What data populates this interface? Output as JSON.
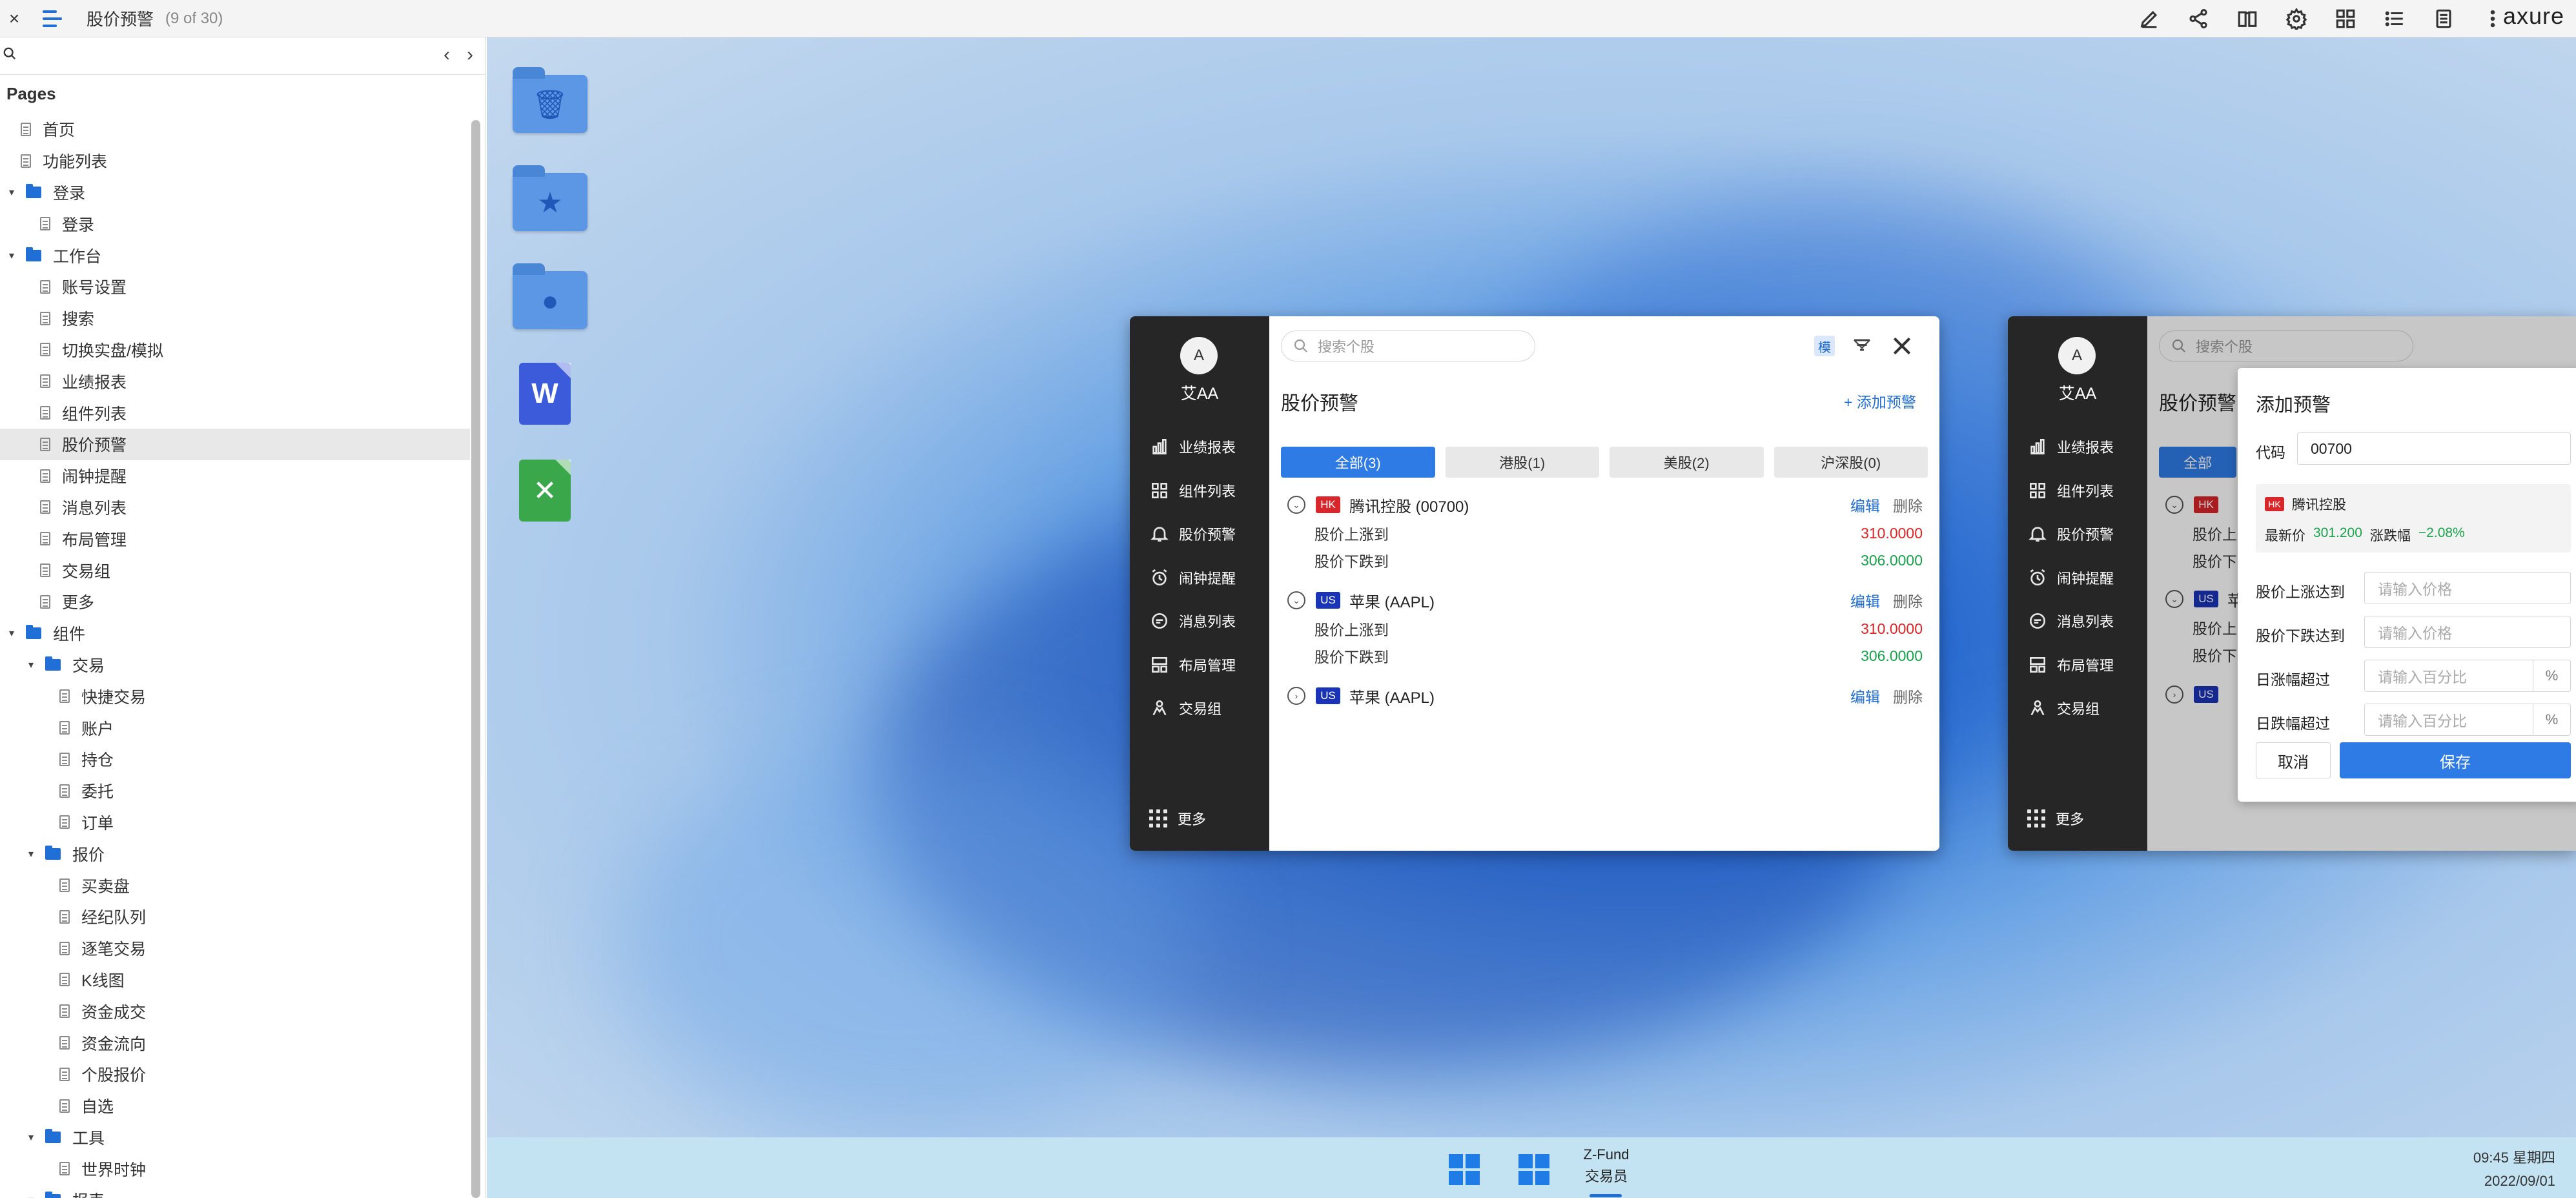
{
  "topbar": {
    "close_glyph": "×",
    "page_name": "股价预警",
    "page_count": "(9 of 30)",
    "tool_icons": [
      "pencil-icon",
      "share-icon",
      "book-icon",
      "settings-icon",
      "grid-icon",
      "list-icon",
      "document-icon",
      "more-icon"
    ],
    "brand": "axure"
  },
  "sidebar": {
    "nav_prev": "‹",
    "nav_next": "›",
    "pages_title": "Pages",
    "tree": [
      {
        "label": "首页",
        "type": "page",
        "level": 0
      },
      {
        "label": "功能列表",
        "type": "page",
        "level": 0
      },
      {
        "label": "登录",
        "type": "folder",
        "level": 0
      },
      {
        "label": "登录",
        "type": "page",
        "level": 1
      },
      {
        "label": "工作台",
        "type": "folder",
        "level": 0
      },
      {
        "label": "账号设置",
        "type": "page",
        "level": 1
      },
      {
        "label": "搜索",
        "type": "page",
        "level": 1
      },
      {
        "label": "切换实盘/模拟",
        "type": "page",
        "level": 1
      },
      {
        "label": "业绩报表",
        "type": "page",
        "level": 1
      },
      {
        "label": "组件列表",
        "type": "page",
        "level": 1
      },
      {
        "label": "股价预警",
        "type": "page",
        "level": 1,
        "selected": true
      },
      {
        "label": "闹钟提醒",
        "type": "page",
        "level": 1
      },
      {
        "label": "消息列表",
        "type": "page",
        "level": 1
      },
      {
        "label": "布局管理",
        "type": "page",
        "level": 1
      },
      {
        "label": "交易组",
        "type": "page",
        "level": 1
      },
      {
        "label": "更多",
        "type": "page",
        "level": 1
      },
      {
        "label": "组件",
        "type": "folder",
        "level": 0
      },
      {
        "label": "交易",
        "type": "folder",
        "level": 1
      },
      {
        "label": "快捷交易",
        "type": "page",
        "level": 2
      },
      {
        "label": "账户",
        "type": "page",
        "level": 2
      },
      {
        "label": "持仓",
        "type": "page",
        "level": 2
      },
      {
        "label": "委托",
        "type": "page",
        "level": 2
      },
      {
        "label": "订单",
        "type": "page",
        "level": 2
      },
      {
        "label": "报价",
        "type": "folder",
        "level": 1
      },
      {
        "label": "买卖盘",
        "type": "page",
        "level": 2
      },
      {
        "label": "经纪队列",
        "type": "page",
        "level": 2
      },
      {
        "label": "逐笔交易",
        "type": "page",
        "level": 2
      },
      {
        "label": "K线图",
        "type": "page",
        "level": 2
      },
      {
        "label": "资金成交",
        "type": "page",
        "level": 2
      },
      {
        "label": "资金流向",
        "type": "page",
        "level": 2
      },
      {
        "label": "个股报价",
        "type": "page",
        "level": 2
      },
      {
        "label": "自选",
        "type": "page",
        "level": 2
      },
      {
        "label": "工具",
        "type": "folder",
        "level": 1
      },
      {
        "label": "世界时钟",
        "type": "page",
        "level": 2
      },
      {
        "label": "报表",
        "type": "folder",
        "level": 1
      }
    ]
  },
  "desktop": {
    "icons": [
      "trash-folder-icon",
      "favorites-folder-icon",
      "user-folder-icon",
      "word-doc-icon",
      "excel-doc-icon"
    ],
    "word_glyph": "W",
    "excel_glyph": "✕"
  },
  "app": {
    "avatar_letter": "A",
    "username": "艾AA",
    "nav": [
      {
        "label": "业绩报表",
        "icon": "bar-chart-icon"
      },
      {
        "label": "组件列表",
        "icon": "components-icon"
      },
      {
        "label": "股价预警",
        "icon": "bell-icon"
      },
      {
        "label": "闹钟提醒",
        "icon": "alarm-clock-icon"
      },
      {
        "label": "消息列表",
        "icon": "message-icon"
      },
      {
        "label": "布局管理",
        "icon": "layout-icon"
      },
      {
        "label": "交易组",
        "icon": "group-icon"
      }
    ],
    "more_label": "更多",
    "search_placeholder": "搜索个股",
    "mode_chip": "模",
    "title": "股价预警",
    "add_alert": "+ 添加预警",
    "tabs": [
      {
        "label": "全部(3)",
        "active": true
      },
      {
        "label": "港股(1)",
        "active": false
      },
      {
        "label": "美股(2)",
        "active": false
      },
      {
        "label": "沪深股(0)",
        "active": false
      }
    ],
    "edit_label": "编辑",
    "delete_label": "删除",
    "alerts": [
      {
        "market": "HK",
        "market_color": "#d9262b",
        "name": "腾讯控股 (00700)",
        "expanded": true,
        "conditions": [
          {
            "label": "股价上涨到",
            "value": "310.0000",
            "dir": "up"
          },
          {
            "label": "股价下跌到",
            "value": "306.0000",
            "dir": "down"
          }
        ]
      },
      {
        "market": "US",
        "market_color": "#1a34b8",
        "name": "苹果 (AAPL)",
        "expanded": true,
        "conditions": [
          {
            "label": "股价上涨到",
            "value": "310.0000",
            "dir": "up"
          },
          {
            "label": "股价下跌到",
            "value": "306.0000",
            "dir": "down"
          }
        ]
      },
      {
        "market": "US",
        "market_color": "#1a34b8",
        "name": "苹果 (AAPL)",
        "expanded": false,
        "conditions": []
      }
    ]
  },
  "app2": {
    "partial_tab": "全部",
    "partial_rows": [
      "股价上",
      "股价下",
      "股价上",
      "股价下"
    ],
    "partial_name": "苹"
  },
  "modal": {
    "title": "添加预警",
    "code_label": "代码",
    "code_value": "00700",
    "quote_market": "HK",
    "quote_name": "腾讯控股",
    "latest_label": "最新价",
    "latest_value": "301.200",
    "change_label": "涨跌幅",
    "change_value": "−2.08%",
    "rise_label": "股价上涨达到",
    "rise_placeholder": "请输入价格",
    "fall_label": "股价下跌达到",
    "fall_placeholder": "请输入价格",
    "day_up_label": "日涨幅超过",
    "day_up_placeholder": "请输入百分比",
    "day_down_label": "日跌幅超过",
    "day_down_placeholder": "请输入百分比",
    "percent": "%",
    "cancel": "取消",
    "save": "保存"
  },
  "taskbar": {
    "app_name": "Z-Fund",
    "app_sub": "交易员",
    "time": "09:45 星期四",
    "date": "2022/09/01"
  },
  "colors": {
    "accent": "#2f7be6",
    "rail": "#262626",
    "up": "#e02424",
    "down": "#16a34a",
    "hk_badge": "#d9262b",
    "us_badge": "#1a34b8"
  }
}
